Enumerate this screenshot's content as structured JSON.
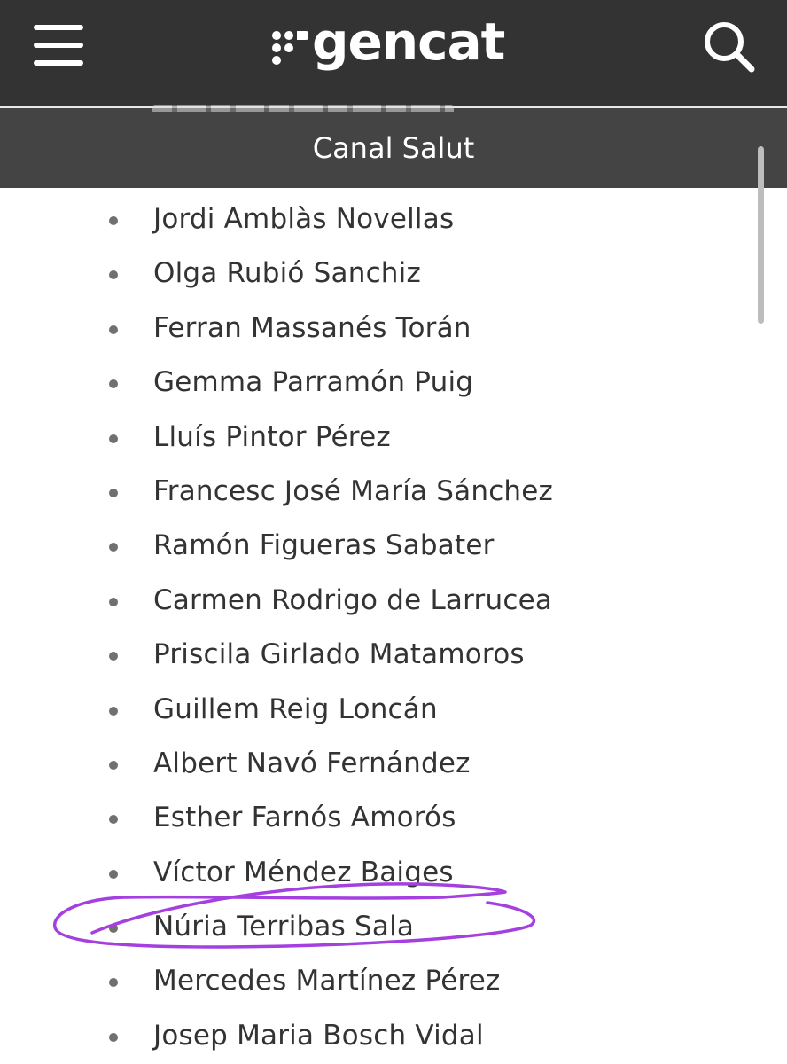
{
  "header": {
    "menu_icon": "hamburger-menu-icon",
    "logo_text": "gencat",
    "search_icon": "search-icon",
    "background_color": "#333333"
  },
  "subheader": {
    "title": "Canal Salut",
    "background_color": "#444444"
  },
  "names": [
    "Jordi Amblàs Novellas",
    "Olga Rubió Sanchiz",
    "Ferran Massanés Torán",
    "Gemma Parramón Puig",
    "Lluís Pintor Pérez",
    "Francesc José María Sánchez",
    "Ramón Figueras Sabater",
    "Carmen Rodrigo de Larrucea",
    "Priscila Girlado Matamoros",
    "Guillem Reig Loncán",
    "Albert Navó Fernández",
    "Esther Farnós Amorós",
    "Víctor Méndez Baiges",
    "Núria Terribas Sala",
    "Mercedes Martínez Pérez",
    "Josep Maria Bosch Vidal"
  ],
  "highlight": {
    "circled_name": "Núria Terribas Sala",
    "color": "#a43fe0"
  }
}
